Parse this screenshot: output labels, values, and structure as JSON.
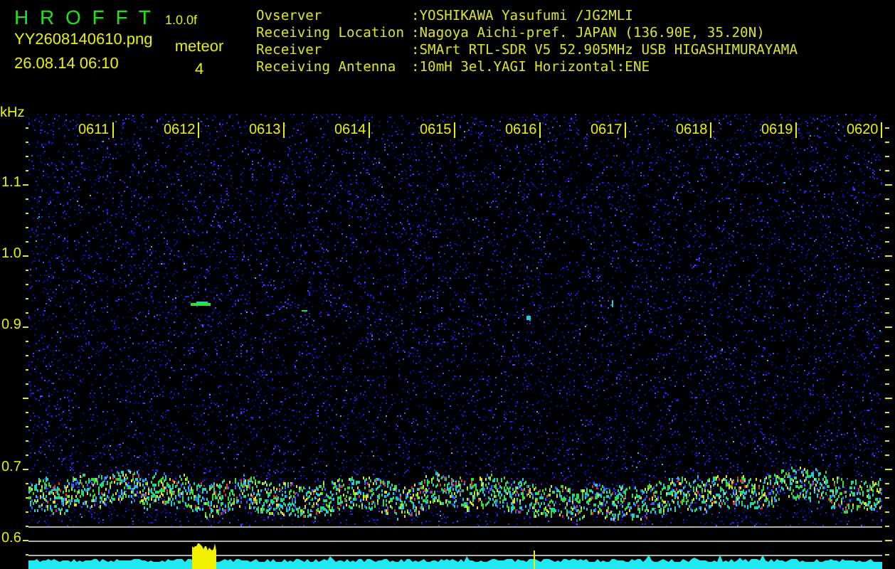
{
  "header": {
    "app_title": "H R O F F T",
    "version": "1.0.0f",
    "filename": "YY2608140610.png",
    "timestamp": "26.08.14 06:10",
    "meteor_label": "meteor",
    "meteor_count": "4"
  },
  "station_info": [
    {
      "label": "Ovserver",
      "value": ":YOSHIKAWA Yasufumi /JG2MLI"
    },
    {
      "label": "Receiving Location",
      "value": ":Nagoya Aichi-pref. JAPAN (136.90E, 35.20N)"
    },
    {
      "label": "Receiver",
      "value": ":SMArt RTL-SDR V5 52.905MHz USB HIGASHIMURAYAMA"
    },
    {
      "label": "Receiving Antenna",
      "value": ":10mH 3el.YAGI Horizontal:ENE"
    }
  ],
  "spectrogram": {
    "unit": "kHz",
    "frequency_labels": [
      "1.1",
      "1.0",
      "0.9",
      "0.7",
      "0.6"
    ],
    "time_labels": [
      "0611",
      "0612",
      "0613",
      "0614",
      "0615",
      "0616",
      "0617",
      "0618",
      "0619",
      "0620"
    ]
  }
}
